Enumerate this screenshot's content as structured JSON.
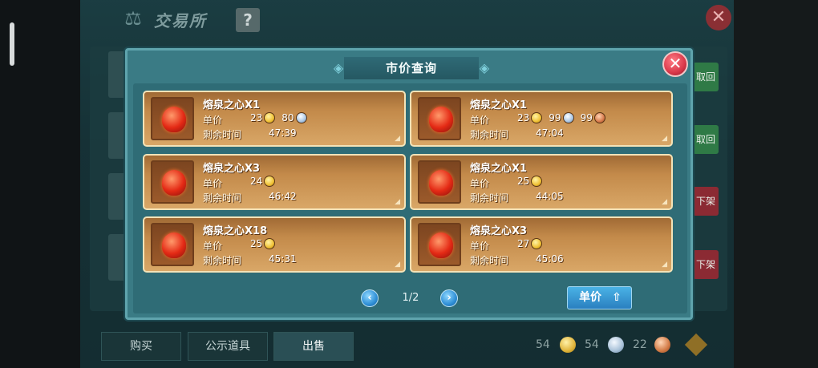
{
  "background": {
    "title": "交易所",
    "help_icon": "?",
    "close_icon": "✕",
    "action_buttons": [
      "取回",
      "取回",
      "下架",
      "下架"
    ],
    "tabs": [
      "购买",
      "公示道具",
      "出售"
    ],
    "currency": {
      "gold": "54",
      "silver": "54",
      "copper": "22"
    }
  },
  "dialog": {
    "title": "市价查询",
    "close_icon": "✕",
    "labels": {
      "price": "单价",
      "time_left": "剩余时间"
    },
    "listings": [
      {
        "name": "熔泉之心X1",
        "price": [
          {
            "coin": "gold",
            "amount": "23"
          },
          {
            "coin": "silver",
            "amount": "80"
          }
        ],
        "time": "47:39"
      },
      {
        "name": "熔泉之心X1",
        "price": [
          {
            "coin": "gold",
            "amount": "23"
          },
          {
            "coin": "silver",
            "amount": "99"
          },
          {
            "coin": "copper",
            "amount": "99"
          }
        ],
        "time": "47:04"
      },
      {
        "name": "熔泉之心X3",
        "price": [
          {
            "coin": "gold",
            "amount": "24"
          }
        ],
        "time": "46:42"
      },
      {
        "name": "熔泉之心X1",
        "price": [
          {
            "coin": "gold",
            "amount": "25"
          }
        ],
        "time": "44:05"
      },
      {
        "name": "熔泉之心X18",
        "price": [
          {
            "coin": "gold",
            "amount": "25"
          }
        ],
        "time": "45:31"
      },
      {
        "name": "熔泉之心X3",
        "price": [
          {
            "coin": "gold",
            "amount": "27"
          }
        ],
        "time": "45:06"
      }
    ],
    "pager": {
      "text": "1/2",
      "prev_icon": "‹",
      "next_icon": "›"
    },
    "sort_button": "单价"
  }
}
